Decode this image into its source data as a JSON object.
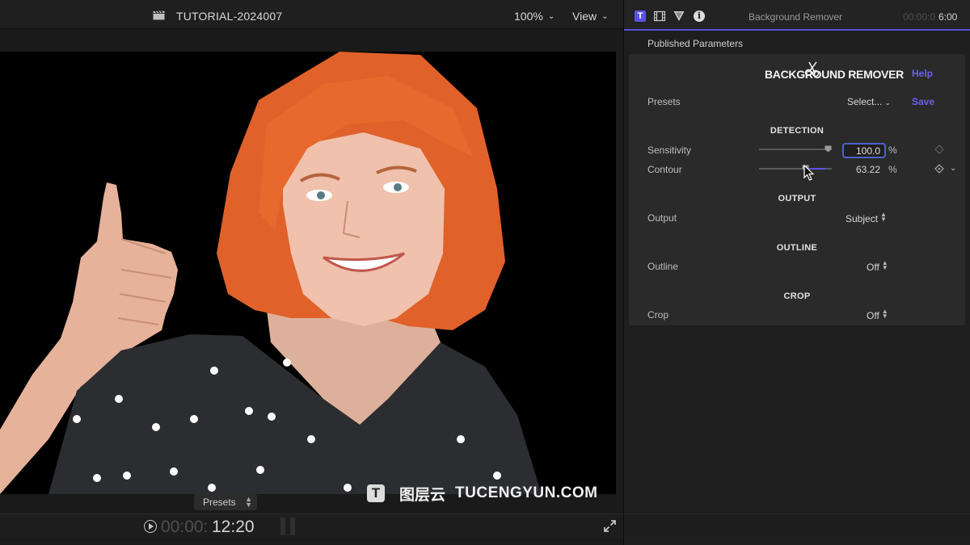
{
  "viewer": {
    "project_title": "TUTORIAL-2024007",
    "zoom": "100%",
    "view_label": "View",
    "presets_label": "Presets",
    "timecode_dim": "00:00:",
    "timecode": "12:20"
  },
  "watermark": {
    "logo_letter": "T",
    "chinese": "图层云",
    "english": "TUCENGYUN.COM"
  },
  "inspector": {
    "tabs": {
      "text_tab_letter": "T",
      "info_tab_letter": "i"
    },
    "title": "Background Remover",
    "timecode_dim": "00:00:0",
    "timecode": "6:00",
    "published_parameters": "Published Parameters",
    "plugin_logo": "BACKGROUND REMOVER",
    "help": "Help",
    "presets_label": "Presets",
    "presets_value": "Select...",
    "save": "Save",
    "sections": {
      "detection": "DETECTION",
      "output": "OUTPUT",
      "outline": "OUTLINE",
      "crop": "CROP"
    },
    "params": {
      "sensitivity_label": "Sensitivity",
      "sensitivity_value": "100.0",
      "sensitivity_fraction": 1.0,
      "contour_label": "Contour",
      "contour_value": "63.22",
      "contour_fraction": 0.6322,
      "percent": "%",
      "output_label": "Output",
      "output_value": "Subject",
      "outline_label": "Outline",
      "outline_value": "Off",
      "crop_label": "Crop",
      "crop_value": "Off"
    }
  },
  "colors": {
    "accent": "#5b52e6",
    "link": "#6a5ff0",
    "field_border": "#4b63c8",
    "hair": "#e0622a"
  }
}
